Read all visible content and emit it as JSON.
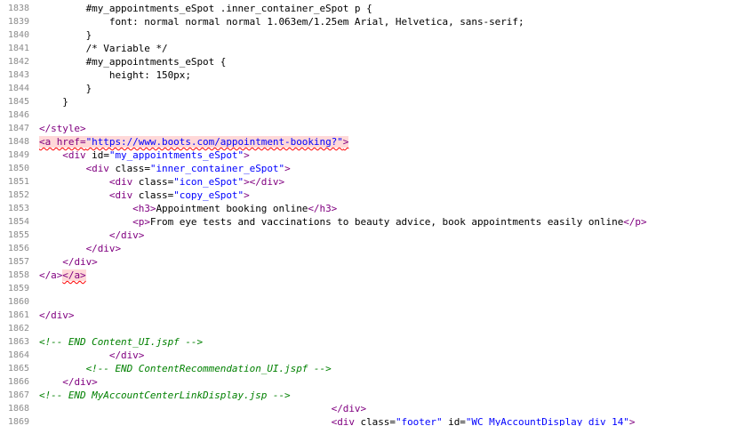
{
  "code_view": {
    "colors": {
      "tag": "#800080",
      "attribute_value": "#0000ff",
      "comment": "#008000",
      "line_number": "#8c8c8c",
      "error_highlight": "#ffd8d8",
      "error_underline": "#ff0000"
    },
    "lines": [
      {
        "number": "1838",
        "parts": [
          {
            "text": "        #my_appointments_eSpot .inner_container_eSpot p {",
            "kind": "plain"
          }
        ]
      },
      {
        "number": "1839",
        "parts": [
          {
            "text": "            font: normal normal normal 1.063em/1.25em Arial, Helvetica, sans-serif;",
            "kind": "plain"
          }
        ]
      },
      {
        "number": "1840",
        "parts": [
          {
            "text": "        }",
            "kind": "plain"
          }
        ]
      },
      {
        "number": "1841",
        "parts": [
          {
            "text": "        /* Variable */",
            "kind": "plain"
          }
        ]
      },
      {
        "number": "1842",
        "parts": [
          {
            "text": "        #my_appointments_eSpot {",
            "kind": "plain"
          }
        ]
      },
      {
        "number": "1843",
        "parts": [
          {
            "text": "            height: 150px;",
            "kind": "plain"
          }
        ]
      },
      {
        "number": "1844",
        "parts": [
          {
            "text": "        }",
            "kind": "plain"
          }
        ]
      },
      {
        "number": "1845",
        "parts": [
          {
            "text": "    }",
            "kind": "plain"
          }
        ]
      },
      {
        "number": "1846",
        "parts": []
      },
      {
        "number": "1847",
        "parts": [
          {
            "text": "</style>",
            "kind": "tag"
          }
        ]
      },
      {
        "number": "1848",
        "parts": [
          {
            "text": "<a href=",
            "kind": "tag",
            "error": true
          },
          {
            "text": "\"https://www.boots.com/appointment-booking?\"",
            "kind": "value",
            "error": true
          },
          {
            "text": ">",
            "kind": "tag",
            "error": true
          }
        ]
      },
      {
        "number": "1849",
        "parts": [
          {
            "text": "    ",
            "kind": "plain"
          },
          {
            "text": "<div ",
            "kind": "tag"
          },
          {
            "text": "id=",
            "kind": "attr"
          },
          {
            "text": "\"my_appointments_eSpot\"",
            "kind": "value"
          },
          {
            "text": ">",
            "kind": "tag"
          }
        ]
      },
      {
        "number": "1850",
        "parts": [
          {
            "text": "        ",
            "kind": "plain"
          },
          {
            "text": "<div ",
            "kind": "tag"
          },
          {
            "text": "class=",
            "kind": "attr"
          },
          {
            "text": "\"inner_container_eSpot\"",
            "kind": "value"
          },
          {
            "text": ">",
            "kind": "tag"
          }
        ]
      },
      {
        "number": "1851",
        "parts": [
          {
            "text": "            ",
            "kind": "plain"
          },
          {
            "text": "<div ",
            "kind": "tag"
          },
          {
            "text": "class=",
            "kind": "attr"
          },
          {
            "text": "\"icon_eSpot\"",
            "kind": "value"
          },
          {
            "text": "></div>",
            "kind": "tag"
          }
        ]
      },
      {
        "number": "1852",
        "parts": [
          {
            "text": "            ",
            "kind": "plain"
          },
          {
            "text": "<div ",
            "kind": "tag"
          },
          {
            "text": "class=",
            "kind": "attr"
          },
          {
            "text": "\"copy_eSpot\"",
            "kind": "value"
          },
          {
            "text": ">",
            "kind": "tag"
          }
        ]
      },
      {
        "number": "1853",
        "parts": [
          {
            "text": "                ",
            "kind": "plain"
          },
          {
            "text": "<h3>",
            "kind": "tag"
          },
          {
            "text": "Appointment booking online",
            "kind": "plain"
          },
          {
            "text": "</h3>",
            "kind": "tag"
          }
        ]
      },
      {
        "number": "1854",
        "parts": [
          {
            "text": "                ",
            "kind": "plain"
          },
          {
            "text": "<p>",
            "kind": "tag"
          },
          {
            "text": "From eye tests and vaccinations to beauty advice, book appointments easily online",
            "kind": "plain"
          },
          {
            "text": "</p>",
            "kind": "tag"
          }
        ]
      },
      {
        "number": "1855",
        "parts": [
          {
            "text": "            ",
            "kind": "plain"
          },
          {
            "text": "</div>",
            "kind": "tag"
          }
        ]
      },
      {
        "number": "1856",
        "parts": [
          {
            "text": "        ",
            "kind": "plain"
          },
          {
            "text": "</div>",
            "kind": "tag"
          }
        ]
      },
      {
        "number": "1857",
        "parts": [
          {
            "text": "    ",
            "kind": "plain"
          },
          {
            "text": "</div>",
            "kind": "tag"
          }
        ]
      },
      {
        "number": "1858",
        "parts": [
          {
            "text": "</a>",
            "kind": "tag"
          },
          {
            "text": "</a>",
            "kind": "tag",
            "error": true
          }
        ]
      },
      {
        "number": "1859",
        "parts": []
      },
      {
        "number": "1860",
        "parts": []
      },
      {
        "number": "1861",
        "parts": [
          {
            "text": "</div>",
            "kind": "tag"
          }
        ]
      },
      {
        "number": "1862",
        "parts": []
      },
      {
        "number": "1863",
        "parts": [
          {
            "text": "<!-- END Content_UI.jspf -->",
            "kind": "comment"
          }
        ]
      },
      {
        "number": "1864",
        "parts": [
          {
            "text": "            ",
            "kind": "plain"
          },
          {
            "text": "</div>",
            "kind": "tag"
          }
        ]
      },
      {
        "number": "1865",
        "parts": [
          {
            "text": "        ",
            "kind": "plain"
          },
          {
            "text": "<!-- END ContentRecommendation_UI.jspf -->",
            "kind": "comment"
          }
        ]
      },
      {
        "number": "1866",
        "parts": [
          {
            "text": "    ",
            "kind": "plain"
          },
          {
            "text": "</div>",
            "kind": "tag"
          }
        ]
      },
      {
        "number": "1867",
        "parts": [
          {
            "text": "<!-- END MyAccountCenterLinkDisplay.jsp -->",
            "kind": "comment"
          }
        ]
      },
      {
        "number": "1868",
        "parts": [
          {
            "text": "                                                  ",
            "kind": "plain"
          },
          {
            "text": "</div>",
            "kind": "tag"
          }
        ]
      },
      {
        "number": "1869",
        "parts": [
          {
            "text": "                                                  ",
            "kind": "plain"
          },
          {
            "text": "<div ",
            "kind": "tag"
          },
          {
            "text": "class=",
            "kind": "attr"
          },
          {
            "text": "\"footer\"",
            "kind": "value"
          },
          {
            "text": " id=",
            "kind": "attr"
          },
          {
            "text": "\"WC_MyAccountDisplay_div_14\"",
            "kind": "value"
          },
          {
            "text": ">",
            "kind": "tag"
          }
        ]
      }
    ]
  }
}
